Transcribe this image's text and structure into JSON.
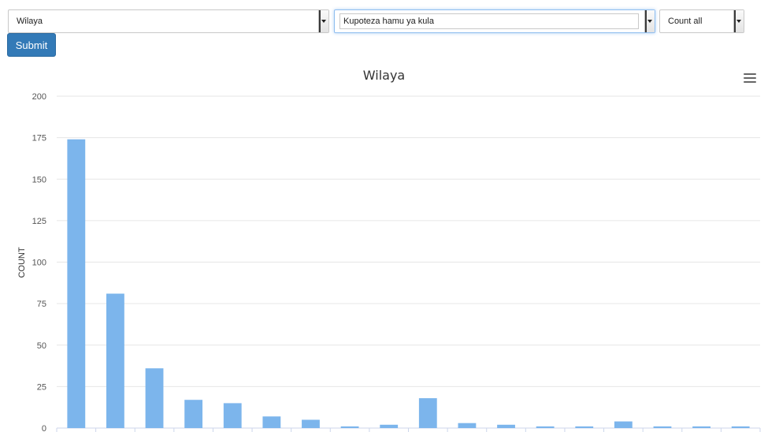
{
  "controls": {
    "region_select": "Wilaya",
    "symptom_select": "Kupoteza hamu ya kula",
    "aggregate_select": "Count all",
    "submit_label": "Submit"
  },
  "colors": {
    "bar": "#7cb5ec",
    "button": "#337ab7",
    "grid": "#e6e6e6"
  },
  "icons": {
    "chart_menu": "hamburger-menu-icon"
  },
  "chart_data": {
    "type": "bar",
    "title": "Wilaya",
    "xlabel": "",
    "ylabel": "COUNT",
    "ylim": [
      0,
      200
    ],
    "yticks": [
      0,
      25,
      50,
      75,
      100,
      125,
      150,
      175,
      200
    ],
    "categories": [
      "",
      "",
      "",
      "",
      "",
      "",
      "",
      "",
      "",
      "",
      "",
      "",
      "",
      "",
      "",
      "",
      "",
      ""
    ],
    "values": [
      174,
      81,
      36,
      17,
      15,
      7,
      5,
      1,
      2,
      18,
      3,
      2,
      1,
      1,
      4,
      1,
      1,
      1
    ],
    "grid": true,
    "legend": false
  }
}
